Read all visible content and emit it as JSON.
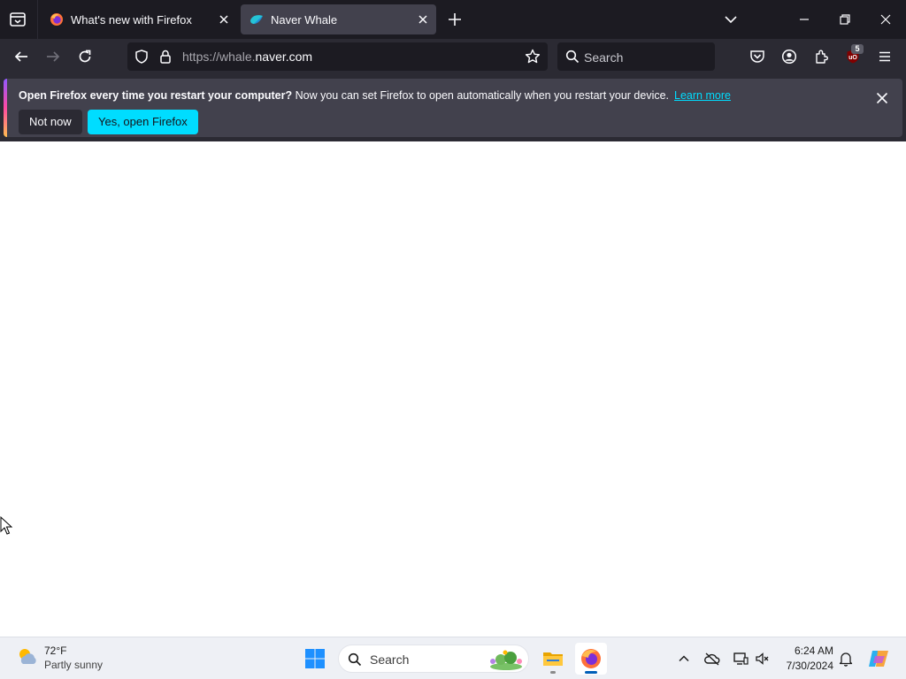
{
  "browser": {
    "tabs": [
      {
        "title": "What's new with Firefox",
        "active": false
      },
      {
        "title": "Naver Whale",
        "active": true
      }
    ],
    "url": {
      "scheme": "https://whale.",
      "host": "naver.com"
    },
    "search_placeholder": "Search",
    "ublock_badge": "5",
    "icons": {
      "tab_list": "tab-list-icon",
      "new_tab": "plus-icon",
      "overflow": "chevron-down-icon",
      "back": "back-arrow-icon",
      "forward": "forward-arrow-icon",
      "reload": "reload-icon",
      "shield": "tracking-shield-icon",
      "lock": "lock-icon",
      "bookmark": "star-icon",
      "pocket": "pocket-icon",
      "account": "account-icon",
      "extensions": "extensions-icon",
      "ublock": "ublock-icon",
      "menu": "hamburger-menu-icon"
    }
  },
  "notification": {
    "bold_text": "Open Firefox every time you restart your computer?",
    "text": " Now you can set Firefox to open automatically when you restart your device.",
    "link": "Learn more",
    "not_now": "Not now",
    "yes": "Yes, open Firefox"
  },
  "taskbar": {
    "weather": {
      "temp": "72°F",
      "desc": "Partly sunny"
    },
    "search_placeholder": "Search",
    "clock": {
      "time": "6:24 AM",
      "date": "7/30/2024"
    },
    "apps": [
      "file-explorer",
      "firefox"
    ]
  },
  "colors": {
    "accent": "#00ddff",
    "tabstrip": "#1c1b22",
    "toolbar": "#2b2a33",
    "active_tab": "#42414d"
  }
}
